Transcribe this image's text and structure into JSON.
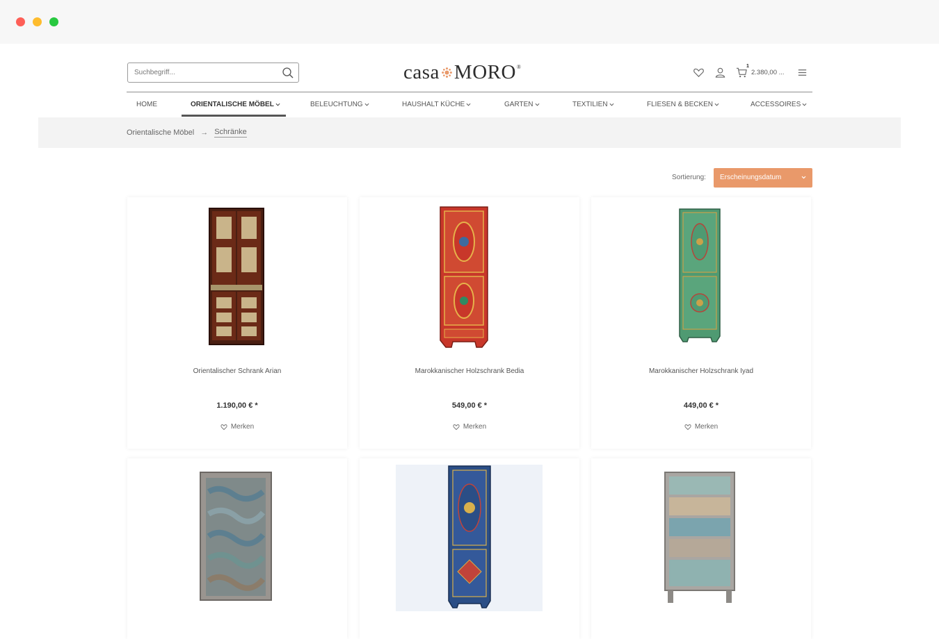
{
  "search": {
    "placeholder": "Suchbegriff..."
  },
  "logo": {
    "left": "casa",
    "right": "MORO",
    "reg": "®"
  },
  "cart": {
    "count": "1",
    "total": "2.380,00 ..."
  },
  "nav": [
    {
      "label": "HOME",
      "dropdown": false
    },
    {
      "label": "ORIENTALISCHE MÖBEL",
      "dropdown": true,
      "active": true
    },
    {
      "label": "BELEUCHTUNG",
      "dropdown": true
    },
    {
      "label": "HAUSHALT KÜCHE",
      "dropdown": true
    },
    {
      "label": "GARTEN",
      "dropdown": true
    },
    {
      "label": "TEXTILIEN",
      "dropdown": true
    },
    {
      "label": "FLIESEN & BECKEN",
      "dropdown": true
    },
    {
      "label": "ACCESSOIRES",
      "dropdown": true
    }
  ],
  "breadcrumb": {
    "parent": "Orientalische Möbel",
    "current": "Schränke"
  },
  "sort": {
    "label": "Sortierung:",
    "value": "Erscheinungsdatum"
  },
  "products": [
    {
      "title": "Orientalischer Schrank Arian",
      "price": "1.190,00 € *",
      "wish": "Merken"
    },
    {
      "title": "Marokkanischer Holzschrank Bedia",
      "price": "549,00 € *",
      "wish": "Merken"
    },
    {
      "title": "Marokkanischer Holzschrank Iyad",
      "price": "449,00 € *",
      "wish": "Merken"
    }
  ],
  "colors": {
    "accent": "#e9996a",
    "nav_text": "#555555"
  }
}
